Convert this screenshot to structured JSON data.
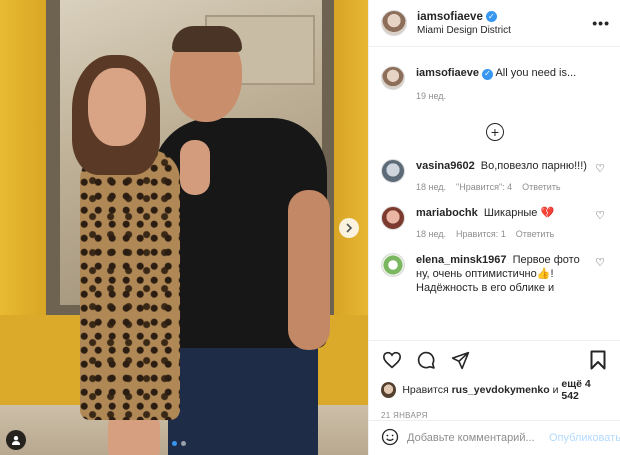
{
  "post": {
    "username": "iamsofiaeve",
    "location": "Miami Design District",
    "carousel": {
      "count": 2,
      "active": 1
    }
  },
  "caption": {
    "username": "iamsofiaeve",
    "text": "All you need is...",
    "age": "19 нед."
  },
  "comments": [
    {
      "username": "vasina9602",
      "text": "Во,повезло парню!!!)",
      "age": "18 нед.",
      "likes": "\"Нравится\": 4",
      "reply": "Ответить"
    },
    {
      "username": "mariabochk",
      "text": "Шикарные",
      "emoji": "💔",
      "age": "18 нед.",
      "likes": "Нравится: 1",
      "reply": "Ответить"
    },
    {
      "username": "elena_minsk1967",
      "text": "Первое фото ну, очень оптимистично👍! Надёжность в его облике и"
    }
  ],
  "likes": {
    "prefix": "Нравится",
    "user": "rus_yevdokymenko",
    "middle": "и",
    "count_text": "ещё 4 542"
  },
  "date": "21 ЯНВАРЯ",
  "add_comment": {
    "placeholder": "Добавьте комментарий...",
    "publish": "Опубликовать"
  },
  "colors": {
    "accent": "#3897f0",
    "publish_disabled": "#b3dbff",
    "wall": "#e3b52d"
  }
}
